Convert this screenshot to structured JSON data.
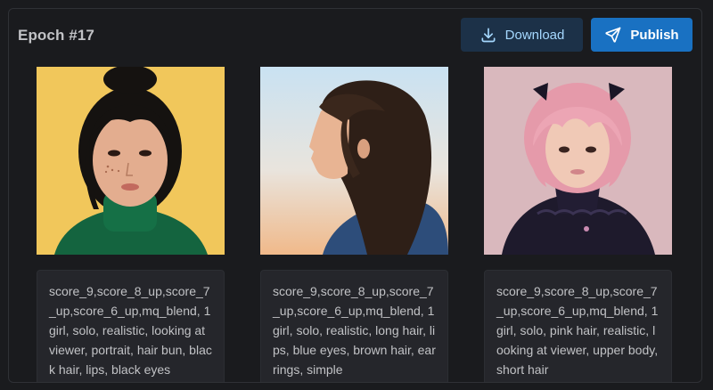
{
  "header": {
    "title": "Epoch #17",
    "download_label": "Download",
    "publish_label": "Publish"
  },
  "cards": [
    {
      "image": "portrait-girl-hair-bun-green-turtleneck",
      "caption": "score_9,score_8_up,score_7_up,score_6_up,mq_blend, 1girl, solo, realistic, looking at viewer, portrait, hair bun, black hair, lips, black eyes"
    },
    {
      "image": "profile-girl-long-brown-hair",
      "caption": "score_9,score_8_up,score_7_up,score_6_up,mq_blend, 1girl, solo, realistic, long hair, lips, blue eyes, brown hair, earrings, simple"
    },
    {
      "image": "portrait-girl-pink-hair",
      "caption": "score_9,score_8_up,score_7_up,score_6_up,mq_blend, 1girl, solo, pink hair, realistic, looking at viewer, upper body, short hair"
    }
  ],
  "colors": {
    "background": "#1a1b1e",
    "download_bg": "#1c3148",
    "download_text": "#a5d8ff",
    "publish_bg": "#1971c2"
  }
}
